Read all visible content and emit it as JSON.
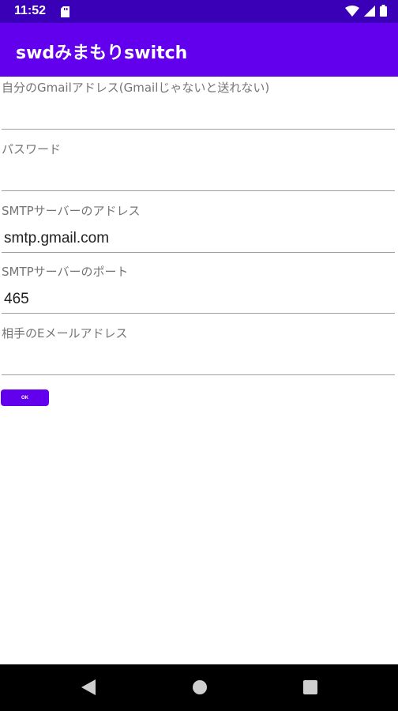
{
  "status_bar": {
    "time": "11:52"
  },
  "app_bar": {
    "title": "swdみまもりswitch"
  },
  "form": {
    "gmail_label": "自分のGmailアドレス(Gmailじゃないと送れない)",
    "gmail_value": "",
    "password_label": "パスワード",
    "password_value": "",
    "smtp_server_label": "SMTPサーバーのアドレス",
    "smtp_server_value": "smtp.gmail.com",
    "smtp_port_label": "SMTPサーバーのポート",
    "smtp_port_value": "465",
    "recipient_label": "相手のEメールアドレス",
    "recipient_value": "",
    "ok_label": "OK"
  },
  "icons": {
    "sd_card": "sd-card-icon",
    "wifi": "wifi-icon",
    "signal": "signal-icon",
    "battery": "battery-icon",
    "back": "back-triangle-icon",
    "home": "home-circle-icon",
    "recents": "recents-square-icon"
  },
  "colors": {
    "primary": "#6200ee",
    "primary_dark": "#3a00b8"
  }
}
